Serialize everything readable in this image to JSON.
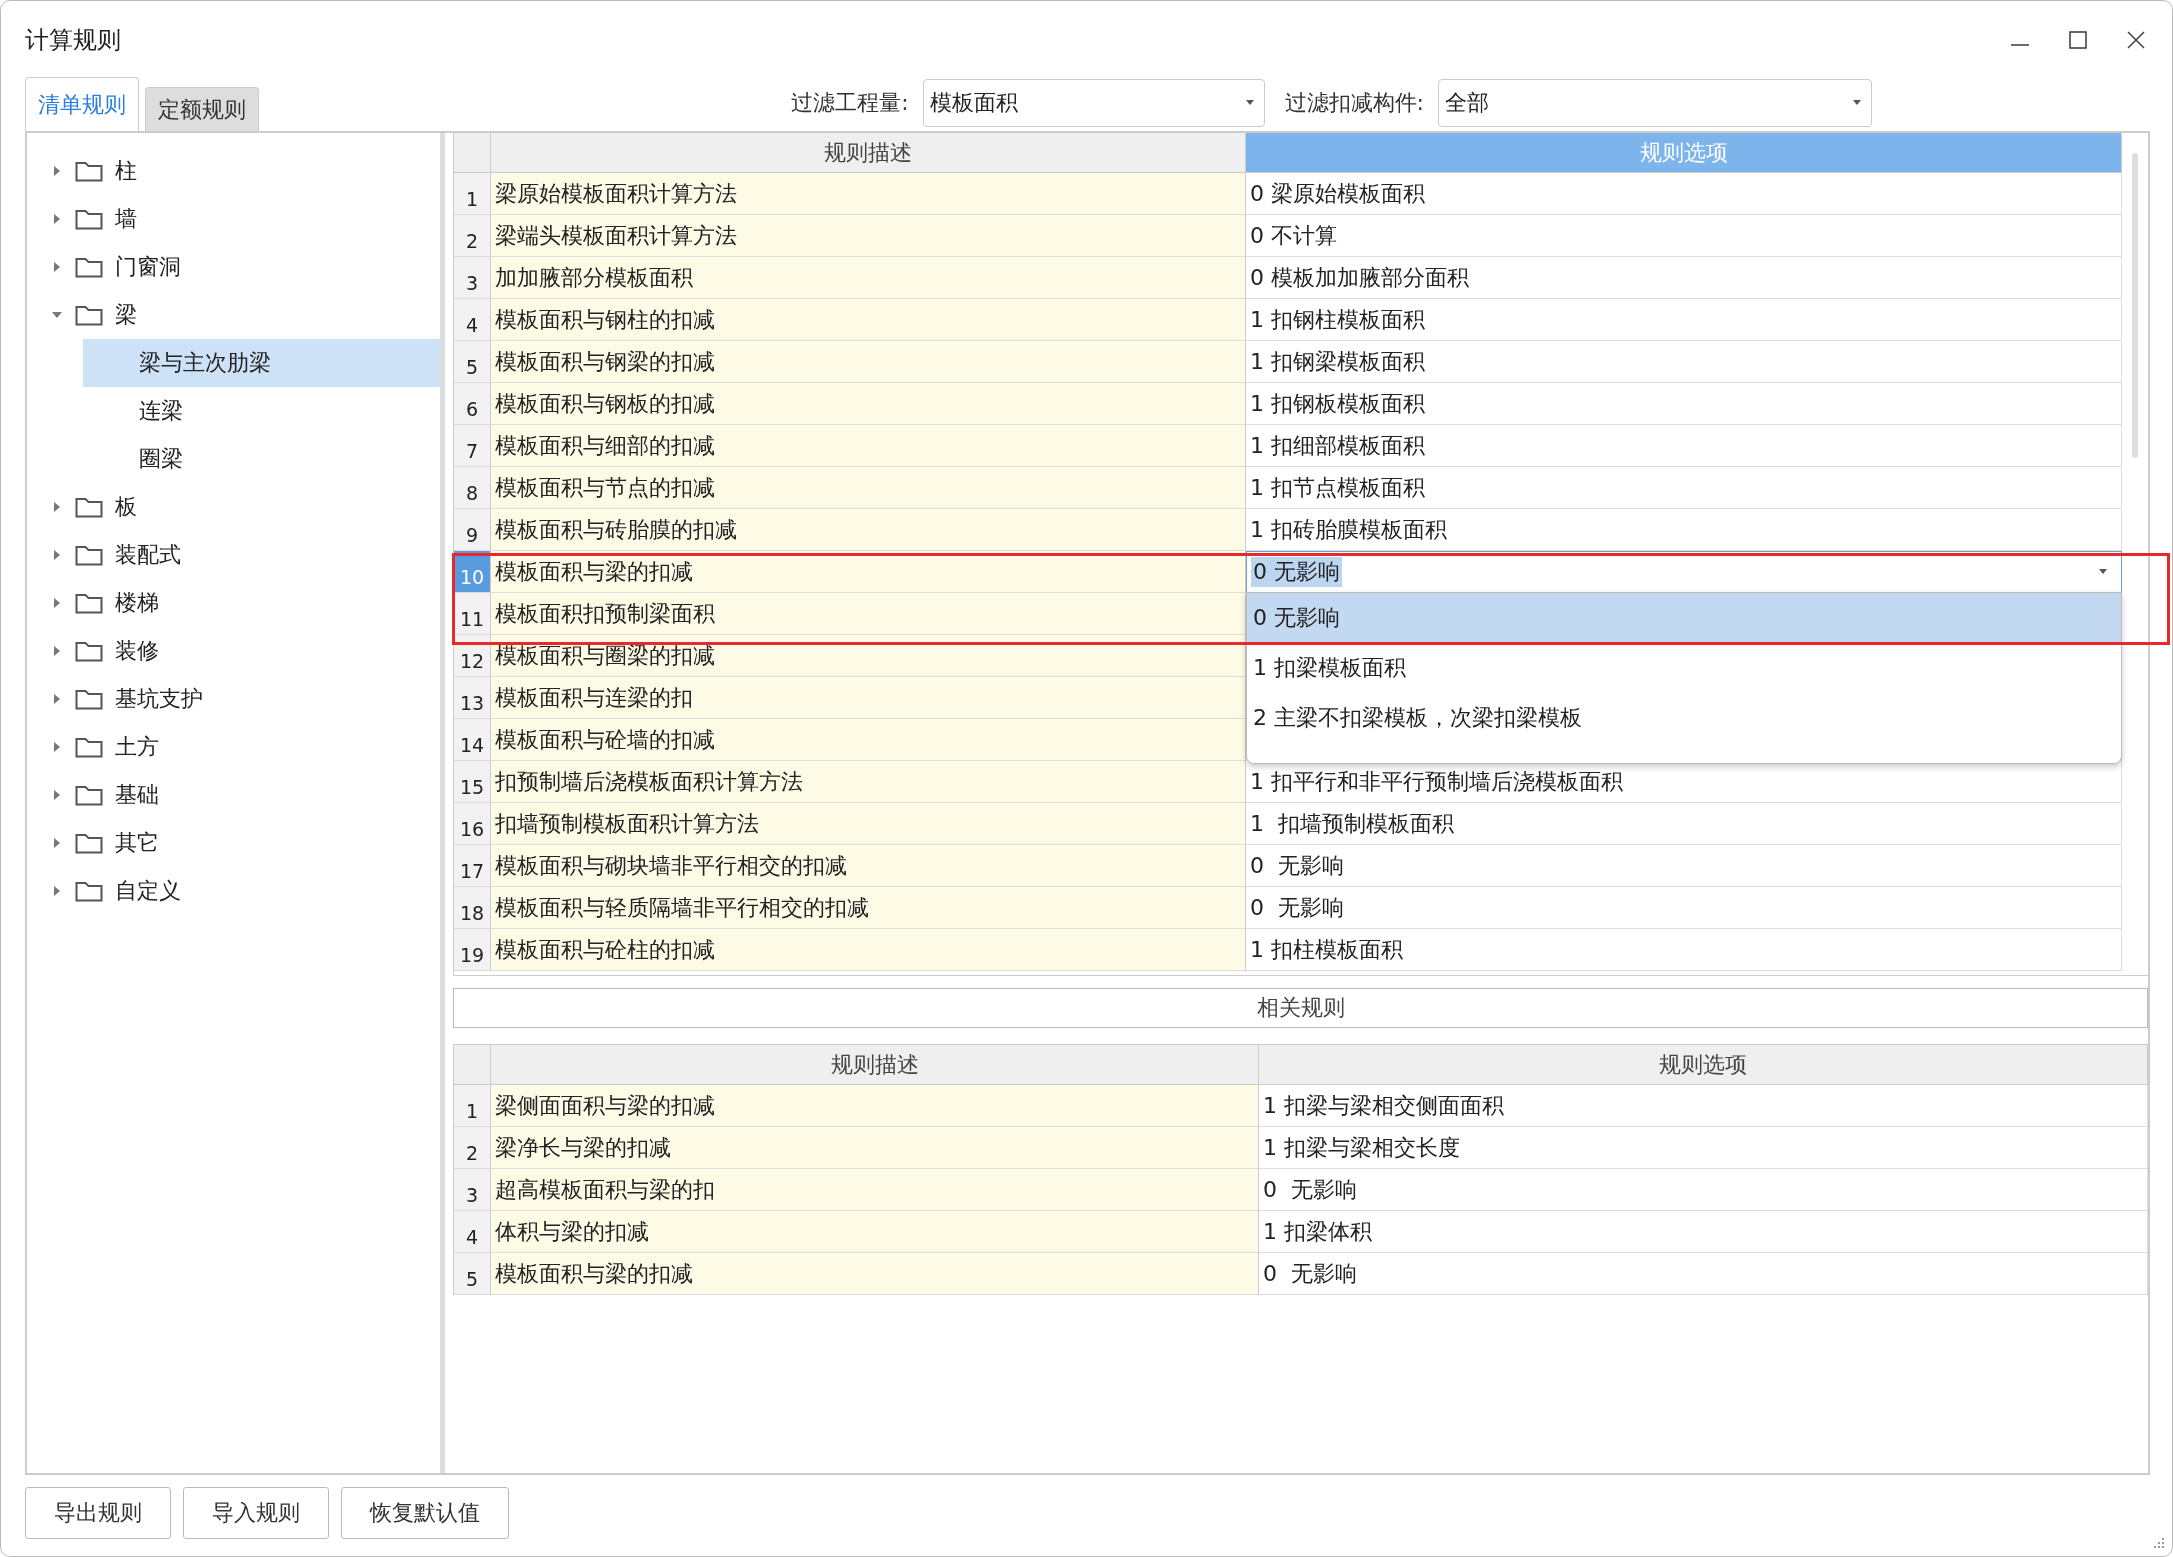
{
  "window": {
    "title": "计算规则"
  },
  "tabs": [
    {
      "label": "清单规则",
      "selected": true
    },
    {
      "label": "定额规则",
      "selected": false
    }
  ],
  "filters": [
    {
      "label": "过滤工程量:",
      "value": "模板面积"
    },
    {
      "label": "过滤扣减构件:",
      "value": "全部"
    }
  ],
  "tree": [
    {
      "label": "柱",
      "expanded": false,
      "selected": false
    },
    {
      "label": "墙",
      "expanded": false,
      "selected": false
    },
    {
      "label": "门窗洞",
      "expanded": false,
      "selected": false
    },
    {
      "label": "梁",
      "expanded": true,
      "selected": false,
      "children": [
        {
          "label": "梁与主次肋梁",
          "selected": true
        },
        {
          "label": "连梁",
          "selected": false
        },
        {
          "label": "圈梁",
          "selected": false
        }
      ]
    },
    {
      "label": "板",
      "expanded": false,
      "selected": false
    },
    {
      "label": "装配式",
      "expanded": false,
      "selected": false
    },
    {
      "label": "楼梯",
      "expanded": false,
      "selected": false
    },
    {
      "label": "装修",
      "expanded": false,
      "selected": false
    },
    {
      "label": "基坑支护",
      "expanded": false,
      "selected": false
    },
    {
      "label": "土方",
      "expanded": false,
      "selected": false
    },
    {
      "label": "基础",
      "expanded": false,
      "selected": false
    },
    {
      "label": "其它",
      "expanded": false,
      "selected": false
    },
    {
      "label": "自定义",
      "expanded": false,
      "selected": false
    }
  ],
  "rules_table": {
    "columns": [
      "规则描述",
      "规则选项"
    ],
    "rows": [
      {
        "number": "1",
        "description": "梁原始模板面积计算方法",
        "option": "0 梁原始模板面积",
        "selected": false
      },
      {
        "number": "2",
        "description": "梁端头模板面积计算方法",
        "option": "0 不计算",
        "selected": false
      },
      {
        "number": "3",
        "description": "加加腋部分模板面积",
        "option": "0 模板加加腋部分面积",
        "selected": false
      },
      {
        "number": "4",
        "description": "模板面积与钢柱的扣减",
        "option": "1 扣钢柱模板面积",
        "selected": false
      },
      {
        "number": "5",
        "description": "模板面积与钢梁的扣减",
        "option": "1 扣钢梁模板面积",
        "selected": false
      },
      {
        "number": "6",
        "description": "模板面积与钢板的扣减",
        "option": "1 扣钢板模板面积",
        "selected": false
      },
      {
        "number": "7",
        "description": "模板面积与细部的扣减",
        "option": "1 扣细部模板面积",
        "selected": false
      },
      {
        "number": "8",
        "description": "模板面积与节点的扣减",
        "option": "1 扣节点模板面积",
        "selected": false
      },
      {
        "number": "9",
        "description": "模板面积与砖胎膜的扣减",
        "option": "1 扣砖胎膜模板面积",
        "selected": false
      },
      {
        "number": "10",
        "description": "模板面积与梁的扣减",
        "option": "0 无影响",
        "selected": true,
        "dropdown": [
          {
            "label": "0 无影响",
            "selected": true
          },
          {
            "label": "1 扣梁模板面积",
            "selected": false
          },
          {
            "label": "2 主梁不扣梁模板，次梁扣梁模板",
            "selected": false
          }
        ]
      },
      {
        "number": "11",
        "description": "模板面积扣预制梁面积",
        "selected": false
      },
      {
        "number": "12",
        "description": "模板面积与圈梁的扣减",
        "selected": false
      },
      {
        "number": "13",
        "description": "模板面积与连梁的扣",
        "selected": false
      },
      {
        "number": "14",
        "description": "模板面积与砼墙的扣减",
        "selected": false
      },
      {
        "number": "15",
        "description": "扣预制墙后浇模板面积计算方法",
        "option": "1 扣平行和非平行预制墙后浇模板面积",
        "selected": false
      },
      {
        "number": "16",
        "description": "扣墙预制模板面积计算方法",
        "option": "1  扣墙预制模板面积",
        "selected": false
      },
      {
        "number": "17",
        "description": "模板面积与砌块墙非平行相交的扣减",
        "option": "0  无影响",
        "selected": false
      },
      {
        "number": "18",
        "description": "模板面积与轻质隔墙非平行相交的扣减",
        "option": "0  无影响",
        "selected": false
      },
      {
        "number": "19",
        "description": "模板面积与砼柱的扣减",
        "option": "1 扣柱模板面积",
        "selected": false
      }
    ]
  },
  "related": {
    "title": "相关规则",
    "columns": [
      "规则描述",
      "规则选项"
    ],
    "rows": [
      {
        "number": "1",
        "description": "梁侧面面积与梁的扣减",
        "option": "1 扣梁与梁相交侧面面积"
      },
      {
        "number": "2",
        "description": "梁净长与梁的扣减",
        "option": "1 扣梁与梁相交长度"
      },
      {
        "number": "3",
        "description": "超高模板面积与梁的扣",
        "option": "0  无影响"
      },
      {
        "number": "4",
        "description": "体积与梁的扣减",
        "option": "1 扣梁体积"
      },
      {
        "number": "5",
        "description": "模板面积与梁的扣减",
        "option": "0  无影响"
      }
    ]
  },
  "buttons": [
    "导出规则",
    "导入规则",
    "恢复默认值"
  ]
}
